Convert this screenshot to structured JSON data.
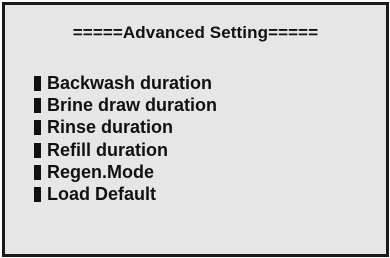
{
  "header": {
    "title": "=====Advanced Setting====="
  },
  "menu": {
    "items": [
      {
        "label": "Backwash duration"
      },
      {
        "label": "Brine draw duration"
      },
      {
        "label": "Rinse duration"
      },
      {
        "label": "Refill duration"
      },
      {
        "label": "Regen.Mode"
      },
      {
        "label": "Load Default"
      }
    ]
  }
}
